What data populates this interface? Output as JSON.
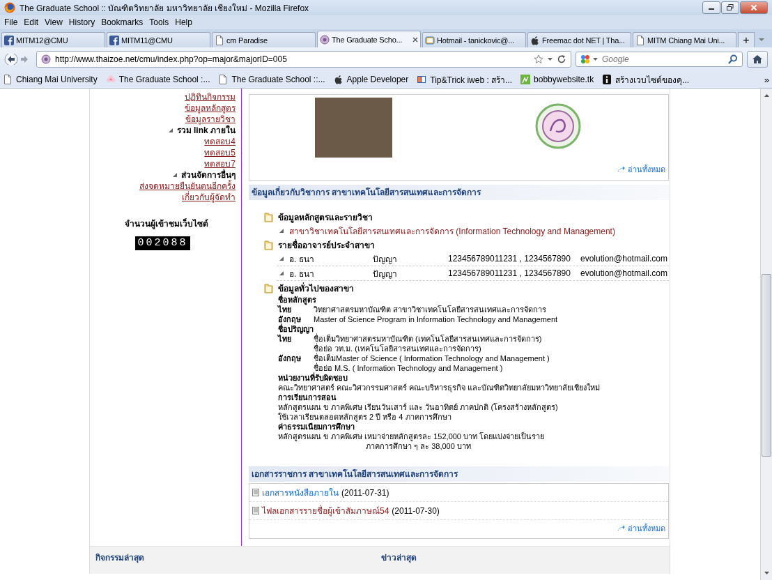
{
  "window": {
    "title": "The Graduate School :: บัณฑิตวิทยาลัย มหาวิทยาลัย เชียงใหม่ - Mozilla Firefox"
  },
  "menu": [
    "File",
    "Edit",
    "View",
    "History",
    "Bookmarks",
    "Tools",
    "Help"
  ],
  "tabs": [
    {
      "label": "MITM12@CMU",
      "selected": false
    },
    {
      "label": "MITM11@CMU",
      "selected": false
    },
    {
      "label": "cm Paradise",
      "selected": false
    },
    {
      "label": "The Graduate Scho...",
      "selected": true
    },
    {
      "label": "Hotmail - tanickovic@...",
      "selected": false
    },
    {
      "label": "Freemac dot NET | Tha...",
      "selected": false
    },
    {
      "label": "MITM Chiang Mai Uni...",
      "selected": false
    }
  ],
  "new_tab": "+",
  "address": {
    "url": "http://www.thaizoe.net/cmu/index.php?op=major&majorID=005"
  },
  "search": {
    "placeholder": "Google"
  },
  "bookmarks": [
    {
      "label": "Chiang Mai University"
    },
    {
      "label": "The Graduate School :..."
    },
    {
      "label": "The Graduate School ::..."
    },
    {
      "label": "Apple Developer"
    },
    {
      "label": "Tip&Trick iweb : สร้า..."
    },
    {
      "label": "bobbywebsite.tk"
    },
    {
      "label": "สร้างเวบไซต์ของคุ..."
    }
  ],
  "bookmarks_overflow": "»",
  "sidebar": {
    "items": [
      {
        "kind": "link",
        "label": "ปฏิทินกิจกรรม"
      },
      {
        "kind": "link",
        "label": "ข้อมูลหลักสูตร"
      },
      {
        "kind": "link",
        "label": "ข้อมูลรายวิชา"
      },
      {
        "kind": "header",
        "label": "รวม link ภายใน"
      },
      {
        "kind": "link",
        "label": "ทดสอบ4"
      },
      {
        "kind": "link",
        "label": "ทดสอบ5"
      },
      {
        "kind": "link",
        "label": "ทดสอบ7"
      },
      {
        "kind": "header",
        "label": "ส่วนจัดการอื่นๆ"
      },
      {
        "kind": "link",
        "label": "ส่งจดหมายยืนยันตนอีกครั้ง"
      },
      {
        "kind": "link",
        "label": "เกี่ยวกับผู้จัดทำ"
      }
    ],
    "counter": {
      "label": "จำนวนผู้เข้าชมเว็บไซต์",
      "value": "002088"
    }
  },
  "gallery": {
    "read_all": "อ่านทั้งหมด"
  },
  "academic": {
    "heading": "ข้อมูลเกี่ยวกับวิชาการ สาขาเทคโนโลยีสารสนเทศและการจัดการ",
    "curriculum": {
      "title": "ข้อมูลหลักสูตรและรายวิชา",
      "link": "สาขาวิชาเทคโนโลยีสารสนเทศและการจัดการ (Information Technology and Management)"
    },
    "faculty": {
      "title": "รายชื่ออาจารย์ประจำสาขา",
      "rows": [
        {
          "name": "อ. ธนา",
          "surname": "ปัญญา",
          "phone": "123456789011231 , 1234567890",
          "email": "evolution@hotmail.com"
        },
        {
          "name": "อ. ธนา",
          "surname": "ปัญญา",
          "phone": "123456789011231 , 1234567890",
          "email": "evolution@hotmail.com"
        }
      ]
    },
    "general": {
      "title": "ข้อมูลทั่วไปของสาขา",
      "lines": [
        {
          "kind": "heading",
          "text": "ชื่อหลักสูตร"
        },
        {
          "kind": "pair",
          "label": "ไทย",
          "text": "วิทยาศาสตรมหาบัณฑิต สาขาวิชาเทคโนโลยีสารสนเทศและการจัดการ"
        },
        {
          "kind": "pair",
          "label": "อังกฤษ",
          "text": "Master of Science Program in Information Technology and Management"
        },
        {
          "kind": "heading",
          "text": "ชื่อปริญญา"
        },
        {
          "kind": "pair",
          "label": "ไทย",
          "text": "ชื่อเต็มวิทยาศาสตรมหาบัณฑิต (เทคโนโลยีสารสนเทศและการจัดการ)"
        },
        {
          "kind": "continued",
          "text": "ชื่อย่อ วท.ม. (เทคโนโลยีสารสนเทศและการจัดการ)"
        },
        {
          "kind": "pair",
          "label": "อังกฤษ",
          "text": "ชื่อเต็มMaster of Science ( Information Technology and Management )"
        },
        {
          "kind": "continued",
          "text": "ชื่อย่อ M.S. ( Information Technology and Management )"
        },
        {
          "kind": "heading",
          "text": "หน่วยงานที่รับผิดชอบ"
        },
        {
          "kind": "text",
          "text": "คณะวิทยาศาสตร์ คณะวิศวกรรมศาสตร์ คณะบริหารธุรกิจ และบัณฑิตวิทยาลัยมหาวิทยาลัยเชียงใหม่"
        },
        {
          "kind": "heading",
          "text": "การเรียนการสอน"
        },
        {
          "kind": "text",
          "text": "หลักสูตรแผน ข ภาคพิเศษ เรียนวันเสาร์ และ วันอาทิตย์ ภาคปกติ (โครงสร้างหลักสูตร)"
        },
        {
          "kind": "text",
          "text": "ใช้เวลาเรียนตลอดหลักสูตร 2 ปี หรือ 4 ภาคการศึกษา"
        },
        {
          "kind": "heading",
          "text": "ค่าธรรมเนียมการศึกษา"
        },
        {
          "kind": "text",
          "text": "หลักสูตรแผน ข ภาคพิเศษ เหมาจ่ายหลักสูตรละ 152,000 บาท โดยแบ่งจ่ายเป็นราย"
        },
        {
          "kind": "indented",
          "text": "ภาคการศึกษา ๆ ละ 38,000 บาท"
        }
      ]
    }
  },
  "documents": {
    "heading": "เอกสารราชการ สาขาเทคโนโลยีสารสนเทศและการจัดการ",
    "items": [
      {
        "title": "เอกสารหนังสือภายใน",
        "date": "(2011-07-31)",
        "visited": false
      },
      {
        "title": "ไฟลเอกสารรายชื่อผู้เข้าสัมภาษณ์54",
        "date": "(2011-07-30)",
        "visited": true
      }
    ],
    "read_all": "อ่านทั้งหมด"
  },
  "footer": {
    "headings": [
      "กิจกรรมล่าสุด",
      "ข่าวล่าสุด"
    ]
  }
}
